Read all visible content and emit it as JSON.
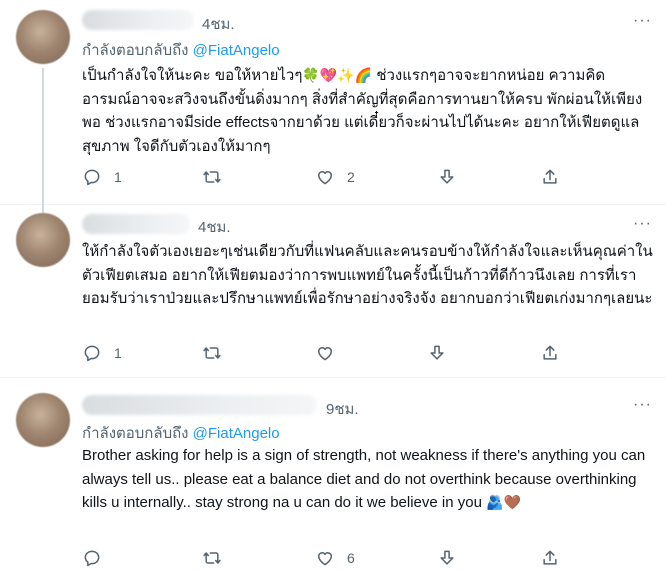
{
  "tweets": [
    {
      "time": "4ชม.",
      "reply_prefix": "กำลังตอบกลับถึง",
      "reply_handle": "@FiatAngelo",
      "text_before_emoji": "เป็นกำลังใจให้นะคะ ขอให้หายไวๆ",
      "emojis": "🍀💖✨🌈",
      "text_after_emoji": " ช่วงแรกๆอาจจะยากหน่อย ความคิดอารมณ์อาจจะสวิงจนถึงขั้นดิ่งมากๆ สิ่งที่สำคัญที่สุดคือการทานยาให้ครบ พักผ่อนให้เพียงพอ ช่วงแรกอาจมีside effectsจากยาด้วย แต่เดี๋ยวก็จะผ่านไปได้นะคะ อยากให้เฟียตดูแลสุขภาพ ใจดีกับตัวเองให้มากๆ",
      "actions": {
        "reply": "1",
        "retweet": "",
        "like": "2"
      }
    },
    {
      "time": "4ชม.",
      "text": "ให้กำลังใจตัวเองเยอะๆเช่นเดียวกับที่แฟนคลับและคนรอบข้างให้กำลังใจและเห็นคุณค่าในตัวเฟียตเสมอ อยากให้เฟียตมองว่าการพบแพทย์ในครั้งนี้เป็นก้าวที่ดีก้าวนึงเลย การที่เรายอมรับว่าเราป่วยและปรึกษาแพทย์เพื่อรักษาอย่างจริงจัง อยากบอกว่าเฟียตเก่งมากๆเลยนะ",
      "actions": {
        "reply": "1",
        "retweet": "",
        "like": ""
      }
    },
    {
      "time": "9ชม.",
      "reply_prefix": "กำลังตอบกลับถึง",
      "reply_handle": "@FiatAngelo",
      "text": "Brother asking for help is a sign of strength, not weakness if there's anything you can always tell us.. please eat a balance diet and do not overthink because overthinking kills u internally.. stay strong na u can do it we believe in you ",
      "emojis": "🫂🤎",
      "actions": {
        "reply": "",
        "retweet": "",
        "like": "6"
      }
    }
  ],
  "more_label": "···"
}
